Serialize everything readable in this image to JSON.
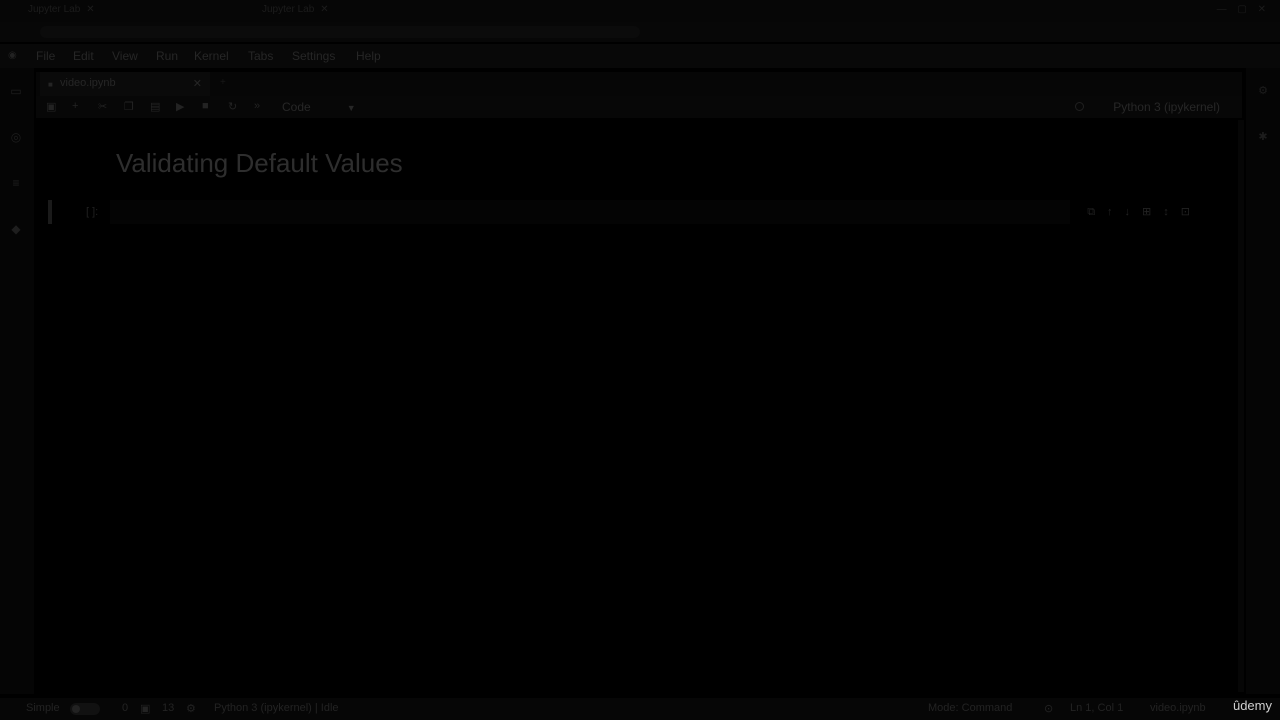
{
  "browser": {
    "tabs": [
      {
        "label": "Jupyter Lab"
      },
      {
        "label": "Jupyter Lab"
      }
    ],
    "controls": "— ▢ ✕"
  },
  "menubar": {
    "items": [
      "File",
      "Edit",
      "View",
      "Run",
      "Kernel",
      "Tabs",
      "Settings",
      "Help"
    ]
  },
  "document_tab": {
    "title": "video.ipynb"
  },
  "toolbar": {
    "cell_type": "Code",
    "kernel": "Python 3 (ipykernel)"
  },
  "notebook": {
    "heading": "Validating Default Values",
    "cell_prompt": "[ ]:"
  },
  "statusbar": {
    "mode": "Simple",
    "count_a": "0",
    "count_b": "13",
    "kernel_status": "Python 3 (ipykernel) | Idle",
    "edit_mode": "Mode: Command",
    "position": "Ln 1, Col 1",
    "file": "video.ipynb"
  },
  "watermark": {
    "text": "ûdemy"
  },
  "colors": {
    "background": "#000000",
    "text_dim": "#2a2a2a",
    "watermark": "#cfcfcf"
  }
}
